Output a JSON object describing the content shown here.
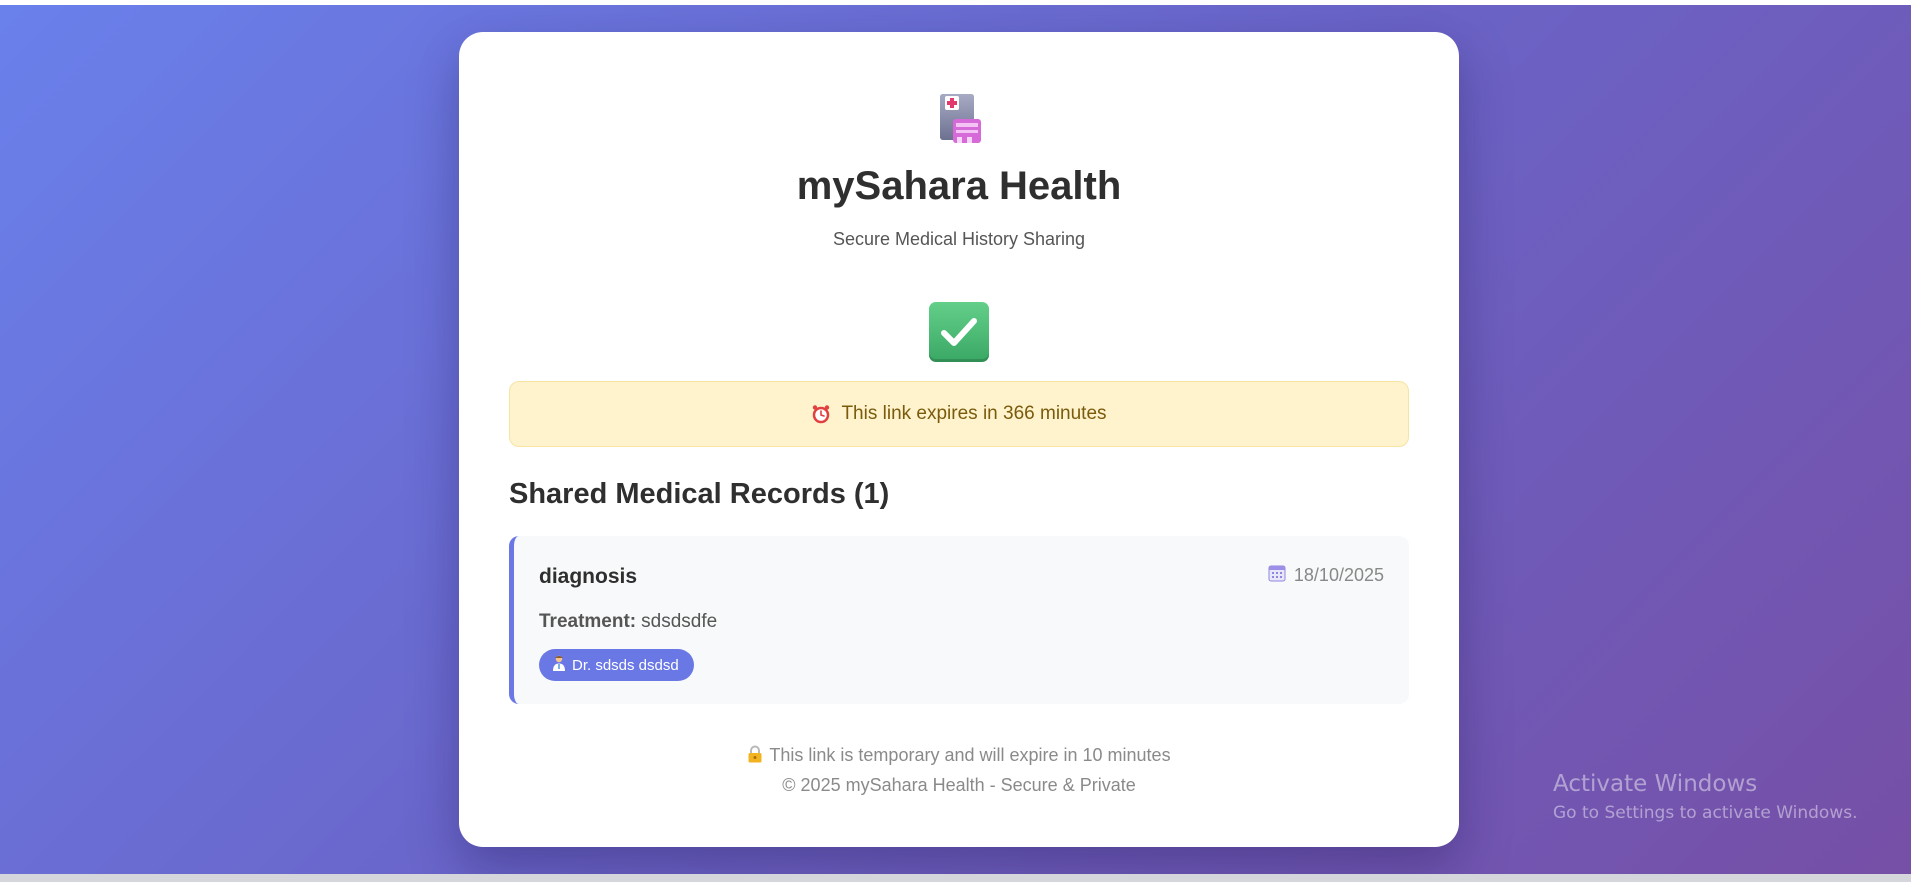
{
  "app": {
    "title": "mySahara Health",
    "subtitle": "Secure Medical History Sharing",
    "logo_icon": "hospital-icon",
    "status_icon": "check-mark-icon"
  },
  "banner": {
    "icon": "alarm-clock-icon",
    "text": "This link expires in 366 minutes"
  },
  "records": {
    "heading": "Shared Medical Records (1)",
    "items": [
      {
        "type": "diagnosis",
        "date_icon": "calendar-icon",
        "date": "18/10/2025",
        "treatment_label": "Treatment:",
        "treatment_value": "sdsdsdfe",
        "doctor_icon": "doctor-icon",
        "doctor": "Dr. sdsds dsdsd"
      }
    ]
  },
  "footer": {
    "lock_icon": "lock-icon",
    "note": "This link is temporary and will expire in 10 minutes",
    "copyright": "© 2025 mySahara Health - Secure & Private"
  },
  "watermark": {
    "title": "Activate Windows",
    "subtitle": "Go to Settings to activate Windows."
  },
  "colors": {
    "accent": "#6a78e6",
    "success": "#4cbb76",
    "banner_bg": "#fef3cd",
    "banner_text": "#7a5b0c"
  }
}
